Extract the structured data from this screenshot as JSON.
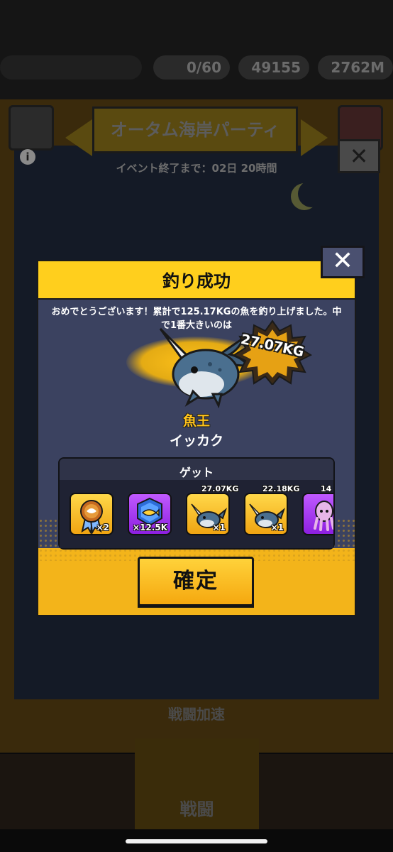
{
  "background": {
    "stamina": "0/60",
    "gems": "49155",
    "coins": "2762M",
    "event_title": "オータム海岸パーティ",
    "event_timer": "イベント終了まで：02日 20時間",
    "boost_label": "戦闘加速",
    "nav_center_label": "戦闘",
    "info_icon": "info-icon",
    "close_icon": "close-icon"
  },
  "modal": {
    "title": "釣り成功",
    "message": "おめでとうございます！累計で125.17KGの魚を釣り上げました。中で1番大きいのは",
    "biggest_weight": "27.07KG",
    "rank_label": "魚王",
    "fish_name": "イッカク",
    "get_title": "ゲット",
    "confirm_label": "確定",
    "close_label": "✕",
    "items": [
      {
        "icon": "medal-icon",
        "qty": "×2",
        "weight": ""
      },
      {
        "icon": "fish-badge-icon",
        "qty": "×12.5K",
        "weight": ""
      },
      {
        "icon": "narwhal-icon",
        "qty": "×1",
        "weight": "27.07KG"
      },
      {
        "icon": "narwhal-icon",
        "qty": "×1",
        "weight": "22.18KG"
      },
      {
        "icon": "squid-icon",
        "qty": "",
        "weight": "14"
      }
    ]
  },
  "colors": {
    "accent_yellow": "#ffcf1d",
    "panel_navy": "#3b4260",
    "item_gold": "#f0a412",
    "item_purple": "#8c1fe0"
  }
}
